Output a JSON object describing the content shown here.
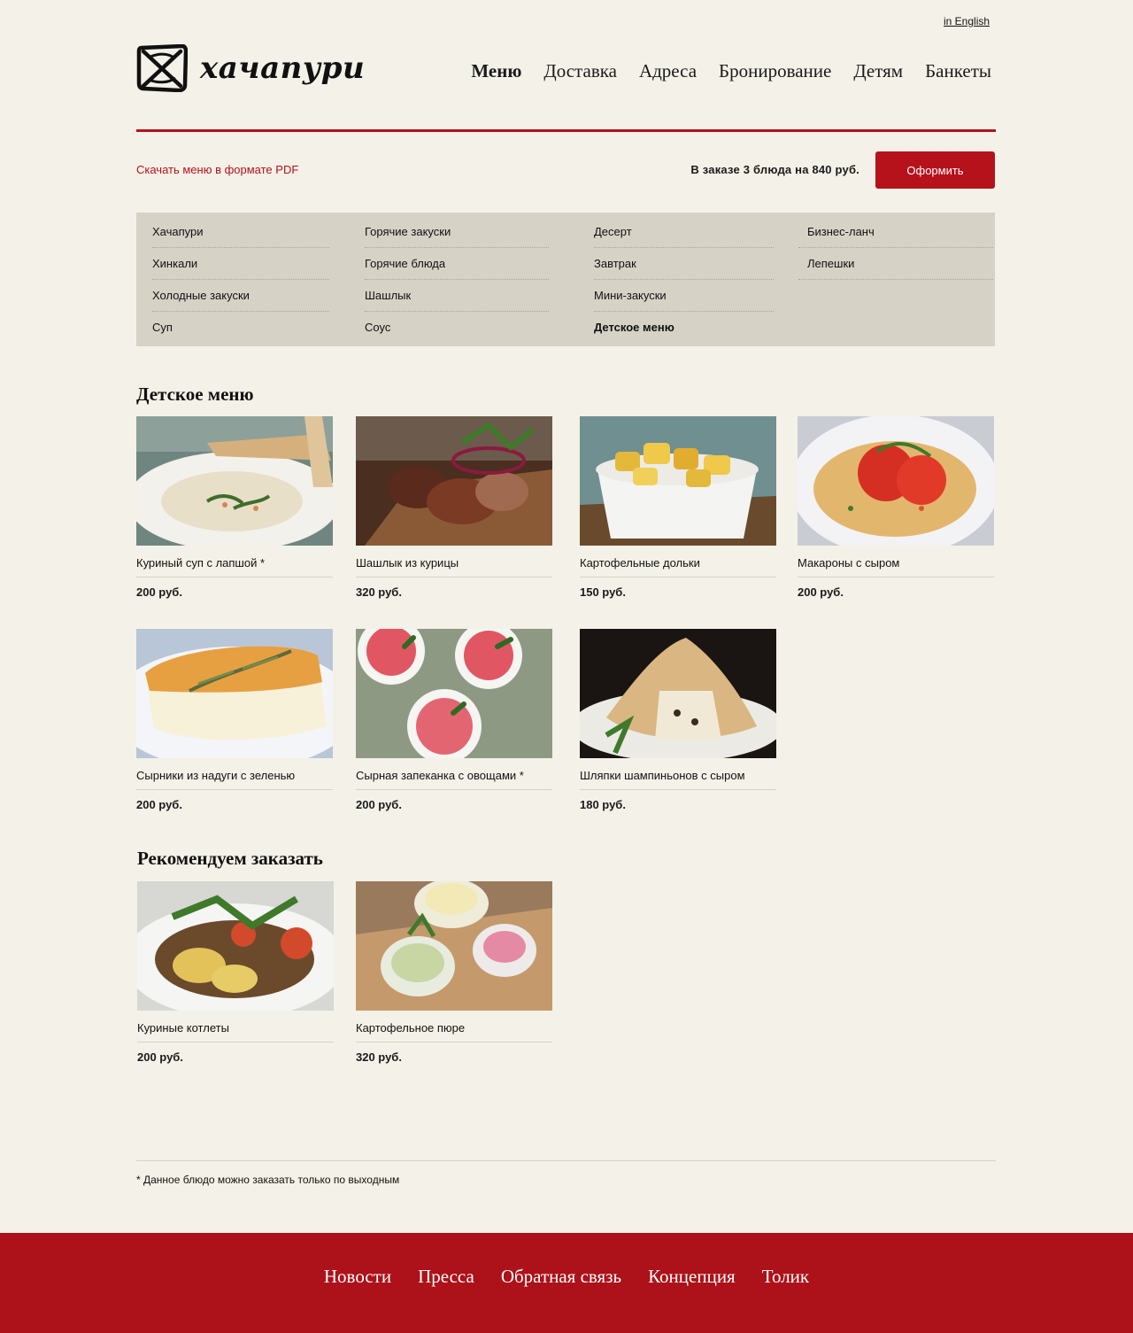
{
  "header": {
    "lang_link": "in English",
    "logo_text": "хачапури",
    "nav": [
      "Меню",
      "Доставка",
      "Адреса",
      "Бронирование",
      "Детям",
      "Банкеты"
    ]
  },
  "toolbar": {
    "pdf_link": "Скачать меню в формате PDF",
    "order_info": "В заказе 3 блюда на 840 руб.",
    "order_button": "Оформить"
  },
  "categories": [
    [
      "Хачапури",
      "Хинкали",
      "Холодные закуски",
      "Суп"
    ],
    [
      "Горячие закуски",
      "Горячие блюда",
      "Шашлык",
      "Соус"
    ],
    [
      "Десерт",
      "Завтрак",
      "Мини-закуски",
      "Детское меню"
    ],
    [
      "Бизнес-ланч",
      "Лепешки"
    ]
  ],
  "kids": {
    "title": "Детское меню",
    "items": [
      {
        "name": "Куриный суп с лапшой *",
        "price": "200 руб."
      },
      {
        "name": "Шашлык из курицы",
        "price": "320 руб."
      },
      {
        "name": "Картофельные дольки",
        "price": "150 руб."
      },
      {
        "name": "Макароны с сыром",
        "price": "200 руб."
      },
      {
        "name": "Сырники из надуги с зеленью",
        "price": "200 руб."
      },
      {
        "name": "Сырная запеканка с овощами *",
        "price": "200 руб."
      },
      {
        "name": "Шляпки шампиньонов с сыром",
        "price": "180 руб."
      }
    ]
  },
  "recommend": {
    "title": "Рекомендуем заказать",
    "items": [
      {
        "name": "Куриные котлеты",
        "price": "200 руб."
      },
      {
        "name": "Картофельное пюре",
        "price": "320 руб."
      }
    ]
  },
  "footnote": "* Данное блюдо можно заказать только по выходным",
  "footer": {
    "nav": [
      "Новости",
      "Пресса",
      "Обратная связь",
      "Концепция",
      "Толик"
    ]
  },
  "colors": {
    "accent": "#b5121b",
    "background": "#f4f1e8",
    "category_panel": "#d6d2c6",
    "footer": "#ad1119"
  }
}
